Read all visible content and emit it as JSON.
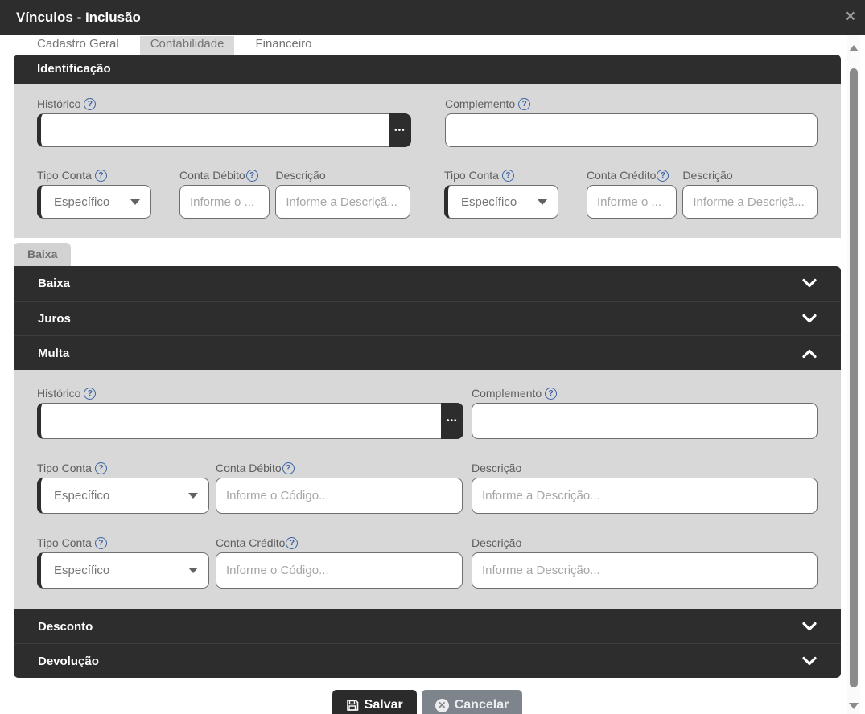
{
  "titlebar": {
    "title": "Vínculos - Inclusão",
    "close_icon": "×"
  },
  "tabs": {
    "items": [
      {
        "label": "Cadastro Geral"
      },
      {
        "label": "Contabilidade"
      },
      {
        "label": "Financeiro"
      }
    ],
    "active": "Contabilidade"
  },
  "help_icon": "?",
  "lookup_button_label": "•••",
  "identificacao": {
    "header": "Identificação",
    "historico": {
      "label": "Histórico",
      "value": ""
    },
    "complemento": {
      "label": "Complemento",
      "value": ""
    },
    "debito": {
      "tipo_conta": {
        "label": "Tipo Conta",
        "selected": "Específico"
      },
      "conta": {
        "label": "Conta Débito",
        "value": "",
        "placeholder": "Informe o ..."
      },
      "descricao": {
        "label": "Descrição",
        "value": "",
        "placeholder": "Informe a Descriçã..."
      }
    },
    "credito": {
      "tipo_conta": {
        "label": "Tipo Conta",
        "selected": "Específico"
      },
      "conta": {
        "label": "Conta Crédito",
        "value": "",
        "placeholder": "Informe o ..."
      },
      "descricao": {
        "label": "Descrição",
        "value": "",
        "placeholder": "Informe a Descriçã..."
      }
    }
  },
  "baixa_tab_label": "Baixa",
  "accordion": {
    "baixa": {
      "label": "Baixa",
      "expanded": false
    },
    "juros": {
      "label": "Juros",
      "expanded": false
    },
    "multa": {
      "label": "Multa",
      "expanded": true
    },
    "desconto": {
      "label": "Desconto",
      "expanded": false
    },
    "devolucao": {
      "label": "Devolução",
      "expanded": false
    }
  },
  "multa_form": {
    "historico": {
      "label": "Histórico",
      "value": ""
    },
    "complemento": {
      "label": "Complemento",
      "value": ""
    },
    "debito": {
      "tipo_conta": {
        "label": "Tipo Conta",
        "selected": "Específico"
      },
      "conta": {
        "label": "Conta Débito",
        "value": "",
        "placeholder": "Informe o Código..."
      },
      "descricao": {
        "label": "Descrição",
        "value": "",
        "placeholder": "Informe a Descrição..."
      }
    },
    "credito": {
      "tipo_conta": {
        "label": "Tipo Conta",
        "selected": "Específico"
      },
      "conta": {
        "label": "Conta Crédito",
        "value": "",
        "placeholder": "Informe o Código..."
      },
      "descricao": {
        "label": "Descrição",
        "value": "",
        "placeholder": "Informe a Descrição..."
      }
    }
  },
  "footer": {
    "save_label": "Salvar",
    "cancel_label": "Cancelar"
  },
  "colors": {
    "dark": "#2d2d2d",
    "panel_gray": "#d8d8d8",
    "help_blue": "#3c64a4",
    "cancel_gray": "#7d848b",
    "active_tab_gray": "#d9d9d9"
  }
}
